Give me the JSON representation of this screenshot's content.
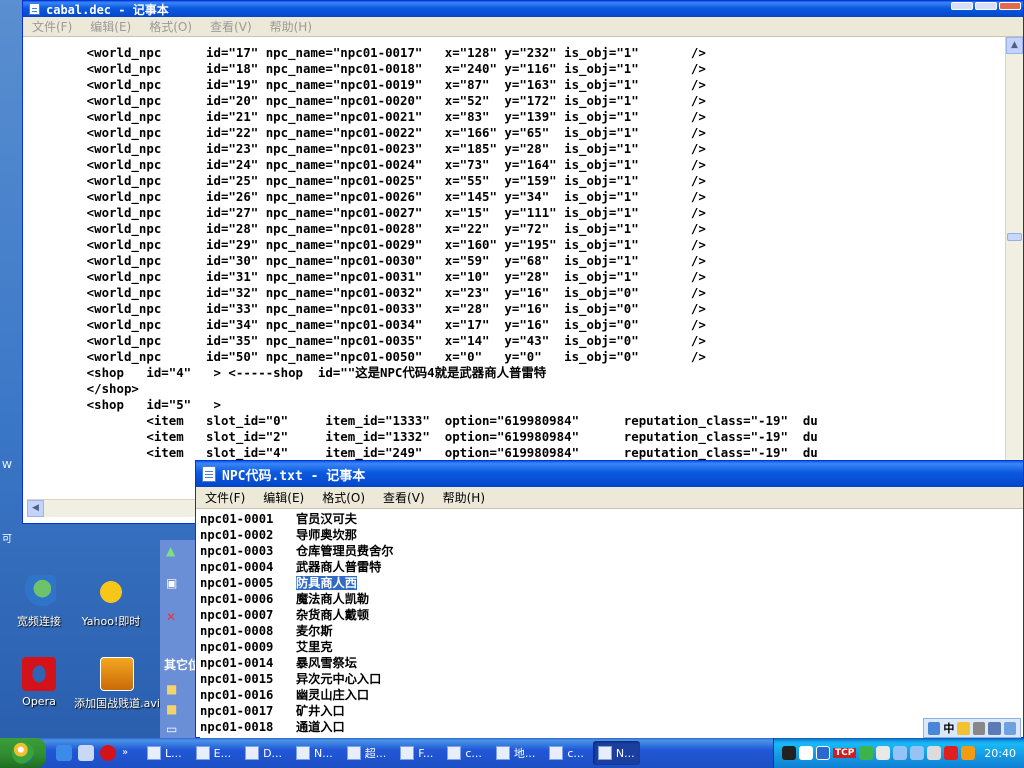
{
  "desktop": {
    "icons": [
      {
        "label": "宽频连接"
      },
      {
        "label": "Yahoo!即时"
      },
      {
        "label": "Opera"
      },
      {
        "label": "添加国战贱道.avi"
      }
    ],
    "explorer_panel": {
      "heading": "其它位",
      "left_edge_text_1": "可",
      "left_edge_text_2": "W"
    }
  },
  "window_cabal": {
    "title": "cabal.dec - 记事本",
    "menu": [
      "文件(F)",
      "编辑(E)",
      "格式(O)",
      "查看(V)",
      "帮助(H)"
    ],
    "lines": [
      "        <world_npc      id=\"17\" npc_name=\"npc01-0017\"   x=\"128\" y=\"232\" is_obj=\"1\"       />",
      "        <world_npc      id=\"18\" npc_name=\"npc01-0018\"   x=\"240\" y=\"116\" is_obj=\"1\"       />",
      "        <world_npc      id=\"19\" npc_name=\"npc01-0019\"   x=\"87\"  y=\"163\" is_obj=\"1\"       />",
      "        <world_npc      id=\"20\" npc_name=\"npc01-0020\"   x=\"52\"  y=\"172\" is_obj=\"1\"       />",
      "        <world_npc      id=\"21\" npc_name=\"npc01-0021\"   x=\"83\"  y=\"139\" is_obj=\"1\"       />",
      "        <world_npc      id=\"22\" npc_name=\"npc01-0022\"   x=\"166\" y=\"65\"  is_obj=\"1\"       />",
      "        <world_npc      id=\"23\" npc_name=\"npc01-0023\"   x=\"185\" y=\"28\"  is_obj=\"1\"       />",
      "        <world_npc      id=\"24\" npc_name=\"npc01-0024\"   x=\"73\"  y=\"164\" is_obj=\"1\"       />",
      "        <world_npc      id=\"25\" npc_name=\"npc01-0025\"   x=\"55\"  y=\"159\" is_obj=\"1\"       />",
      "        <world_npc      id=\"26\" npc_name=\"npc01-0026\"   x=\"145\" y=\"34\"  is_obj=\"1\"       />",
      "        <world_npc      id=\"27\" npc_name=\"npc01-0027\"   x=\"15\"  y=\"111\" is_obj=\"1\"       />",
      "        <world_npc      id=\"28\" npc_name=\"npc01-0028\"   x=\"22\"  y=\"72\"  is_obj=\"1\"       />",
      "        <world_npc      id=\"29\" npc_name=\"npc01-0029\"   x=\"160\" y=\"195\" is_obj=\"1\"       />",
      "        <world_npc      id=\"30\" npc_name=\"npc01-0030\"   x=\"59\"  y=\"68\"  is_obj=\"1\"       />",
      "        <world_npc      id=\"31\" npc_name=\"npc01-0031\"   x=\"10\"  y=\"28\"  is_obj=\"1\"       />",
      "        <world_npc      id=\"32\" npc_name=\"npc01-0032\"   x=\"23\"  y=\"16\"  is_obj=\"0\"       />",
      "        <world_npc      id=\"33\" npc_name=\"npc01-0033\"   x=\"28\"  y=\"16\"  is_obj=\"0\"       />",
      "        <world_npc      id=\"34\" npc_name=\"npc01-0034\"   x=\"17\"  y=\"16\"  is_obj=\"0\"       />",
      "        <world_npc      id=\"35\" npc_name=\"npc01-0035\"   x=\"14\"  y=\"43\"  is_obj=\"0\"       />",
      "        <world_npc      id=\"50\" npc_name=\"npc01-0050\"   x=\"0\"   y=\"0\"   is_obj=\"0\"       />",
      "        <shop   id=\"4\"   > <-----shop  id=\"\"这是NPC代码4就是武器商人普雷特",
      "        </shop>",
      "        <shop   id=\"5\"   >",
      "                <item   slot_id=\"0\"     item_id=\"1333\"  option=\"619980984\"      reputation_class=\"-19\"  du",
      "                <item   slot_id=\"2\"     item_id=\"1332\"  option=\"619980984\"      reputation_class=\"-19\"  du",
      "                <item   slot_id=\"4\"     item_id=\"249\"   option=\"619980984\"      reputation_class=\"-19\"  du"
    ]
  },
  "window_npc": {
    "title": "NPC代码.txt - 记事本",
    "menu": [
      "文件(F)",
      "编辑(E)",
      "格式(O)",
      "查看(V)",
      "帮助(H)"
    ],
    "rows": [
      {
        "code": "npc01-0001",
        "name": "官员汉可夫"
      },
      {
        "code": "npc01-0002",
        "name": "导师奥坎那"
      },
      {
        "code": "npc01-0003",
        "name": "仓库管理员费舍尔"
      },
      {
        "code": "npc01-0004",
        "name": "武器商人普雷特"
      },
      {
        "code": "npc01-0005",
        "name": "防具商人西",
        "selected": true
      },
      {
        "code": "npc01-0006",
        "name": "魔法商人凯勒"
      },
      {
        "code": "npc01-0007",
        "name": "杂货商人戴顿"
      },
      {
        "code": "npc01-0008",
        "name": "麦尔斯"
      },
      {
        "code": "npc01-0009",
        "name": "艾里克"
      },
      {
        "code": "npc01-0014",
        "name": "暴风雪祭坛"
      },
      {
        "code": "npc01-0015",
        "name": "异次元中心入口"
      },
      {
        "code": "npc01-0016",
        "name": "幽灵山庄入口"
      },
      {
        "code": "npc01-0017",
        "name": "矿井入口"
      },
      {
        "code": "npc01-0018",
        "name": "通道入口"
      }
    ]
  },
  "taskbar": {
    "tasks": [
      {
        "label": "L..."
      },
      {
        "label": "E..."
      },
      {
        "label": "D..."
      },
      {
        "label": "N..."
      },
      {
        "label": "超..."
      },
      {
        "label": "F..."
      },
      {
        "label": "c..."
      },
      {
        "label": "地..."
      },
      {
        "label": "c..."
      },
      {
        "label": "N...",
        "active": true
      }
    ],
    "clock": "20:40",
    "tray_tcp": "TCP"
  },
  "langbar": {
    "label": "中"
  },
  "colors": {
    "titlebar": "#0a59e0",
    "selection": "#316ac5",
    "taskbar": "#2157d7"
  }
}
